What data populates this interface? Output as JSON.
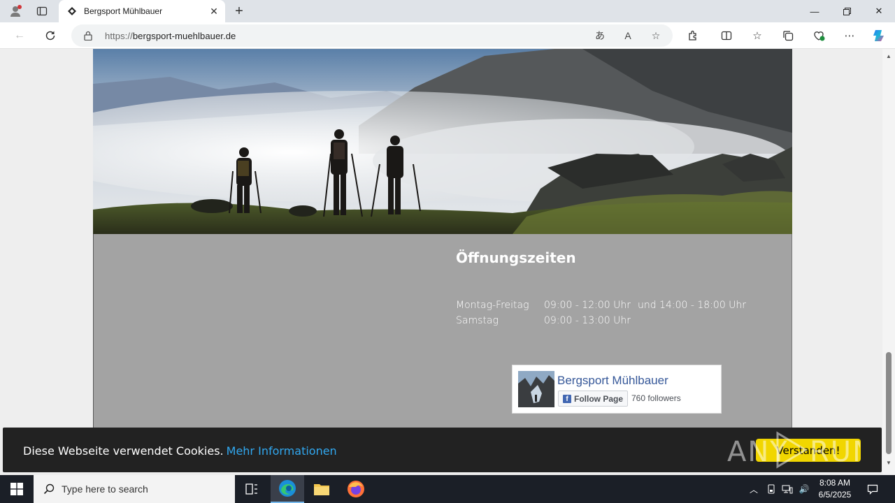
{
  "browser": {
    "tab_title": "Bergsport Mühlbauer",
    "url_scheme": "https://",
    "url_host": "bergsport-muehlbauer.de"
  },
  "hours": {
    "title": "Öffnungszeiten",
    "rows": [
      {
        "day": "Montag-Freitag",
        "time": "09:00 - 12:00 Uhr",
        "extra": "und 14:00 - 18:00 Uhr"
      },
      {
        "day": "Samstag",
        "time": "09:00 - 13:00 Uhr",
        "extra": ""
      }
    ]
  },
  "facebook": {
    "page_name": "Bergsport Mühlbauer",
    "follow_label": "Follow Page",
    "followers": "760 followers"
  },
  "cookie": {
    "text": "Diese Webseite verwendet Cookies.",
    "link": "Mehr Informationen",
    "button": "Verstanden!",
    "watermark": "ANY RUN"
  },
  "taskbar": {
    "search_placeholder": "Type here to search",
    "time": "8:08 AM",
    "date": "6/5/2025"
  }
}
